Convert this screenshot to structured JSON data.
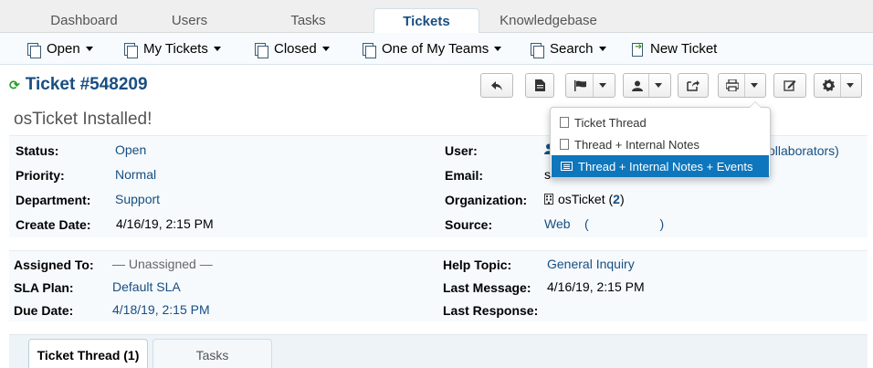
{
  "topnav": {
    "tabs": [
      {
        "label": "Dashboard"
      },
      {
        "label": "Users"
      },
      {
        "label": "Tasks"
      },
      {
        "label": "Tickets"
      },
      {
        "label": "Knowledgebase"
      }
    ],
    "active": "Tickets"
  },
  "subnav": {
    "items": [
      {
        "label": "Open",
        "icon": "pages-icon"
      },
      {
        "label": "My Tickets",
        "icon": "pages-icon"
      },
      {
        "label": "Closed",
        "icon": "pages-icon"
      },
      {
        "label": "One of My Teams",
        "icon": "pages-icon"
      },
      {
        "label": "Search",
        "icon": "pages-icon"
      },
      {
        "label": "New Ticket",
        "icon": "new-ticket-icon"
      }
    ]
  },
  "ticket": {
    "number": "Ticket #548209",
    "subject": "osTicket Installed!"
  },
  "details": {
    "status_label": "Status:",
    "status": "Open",
    "priority_label": "Priority:",
    "priority": "Normal",
    "department_label": "Department:",
    "department": "Support",
    "create_date_label": "Create Date:",
    "create_date": "4/16/19, 2:15 PM",
    "user_label": "User:",
    "user_suffix": "ollaborators)",
    "email_label": "Email:",
    "email": "s",
    "organization_label": "Organization:",
    "organization": "osTicket (",
    "organization_count": "2",
    "organization_close": ")",
    "source_label": "Source:",
    "source": "Web",
    "source_extra": "(                    )"
  },
  "assignment": {
    "assigned_label": "Assigned To:",
    "assigned": "— Unassigned —",
    "sla_label": "SLA Plan:",
    "sla": "Default SLA",
    "due_label": "Due Date:",
    "due": "4/18/19, 2:15 PM",
    "help_topic_label": "Help Topic:",
    "help_topic": "General Inquiry",
    "last_message_label": "Last Message:",
    "last_message": "4/16/19, 2:15 PM",
    "last_response_label": "Last Response:",
    "last_response": ""
  },
  "print_menu": {
    "items": [
      {
        "label": "Ticket Thread"
      },
      {
        "label": "Thread + Internal Notes"
      },
      {
        "label": "Thread + Internal Notes + Events"
      }
    ],
    "selected_index": 2
  },
  "bottom_tabs": [
    {
      "label": "Ticket Thread (1)"
    },
    {
      "label": "Tasks"
    }
  ],
  "colors": {
    "link": "#184E81",
    "selected": "#0e76bc",
    "refresh": "#2c9d2c"
  }
}
